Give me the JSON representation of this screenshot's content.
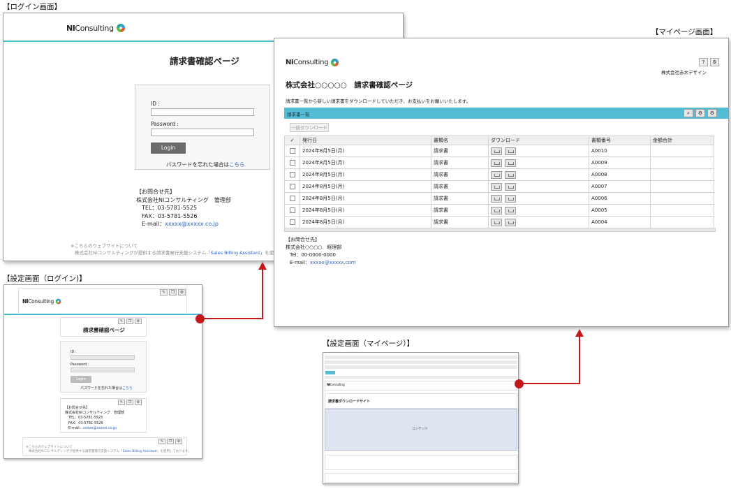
{
  "captions": {
    "login": "【ログイン画面】",
    "mypage": "【マイページ画面】",
    "settings_login": "【設定画面（ログイン)】",
    "settings_mypage": "【設定画面（マイページ）】"
  },
  "brand": {
    "ni": "NI",
    "consulting": "Consulting"
  },
  "login_screen": {
    "title": "請求書確認ページ",
    "id_label": "ID :",
    "password_label": "Password :",
    "login_button": "Login",
    "forgot_text": "パスワードを忘れた場合は",
    "forgot_link": "こちら",
    "contact": {
      "heading": "【お問合せ先】",
      "company": "株式会社NIコンサルティング　管理部",
      "tel": "TEL：03-5781-5525",
      "fax": "FAX：03-5781-5526",
      "email_label": "E-mail：",
      "email": "xxxxx@xxxxx.co.jp"
    },
    "about_heading": "※こちらのウェブサイトについて",
    "about_text": "株式会社NIコンサルティングが提供する請求書発行支援システム「",
    "about_link": "Sales Billing Assistant",
    "about_tail": "」を使用"
  },
  "mypage": {
    "help_icon": "?",
    "company_user": "株式会社赤木デザイン",
    "page_title": "株式会社○○○○○　請求書確認ページ",
    "description": "請求書一覧から新しい請求書をダウンロードしていただき、お支払いをお願いいたします。",
    "list_title": "請求書一覧",
    "bulk_download": "一括ダウンロード",
    "columns": [
      "発行日",
      "書類名",
      "ダウンロード",
      "書類番号",
      "金額合計"
    ],
    "rows": [
      {
        "date": "2024年8月5日(月)",
        "doc": "請求書",
        "no": "A0010"
      },
      {
        "date": "2024年8月5日(月)",
        "doc": "請求書",
        "no": "A0009"
      },
      {
        "date": "2024年8月5日(月)",
        "doc": "請求書",
        "no": "A0008"
      },
      {
        "date": "2024年8月5日(月)",
        "doc": "請求書",
        "no": "A0007"
      },
      {
        "date": "2024年8月5日(月)",
        "doc": "請求書",
        "no": "A0006"
      },
      {
        "date": "2024年8月5日(月)",
        "doc": "請求書",
        "no": "A0005"
      },
      {
        "date": "2024年8月5日(月)",
        "doc": "請求書",
        "no": "A0004"
      }
    ],
    "contact": {
      "heading": "【お問合せ先】",
      "company": "株式会社○○○○　経理部",
      "tel": "Tel：00-0000-0000",
      "email_label": "E-mail：",
      "email": "xxxxx@xxxxx.com"
    }
  },
  "settings_login": {
    "title": "請求書確認ページ",
    "id_label": "ID :",
    "password_label": "Password :",
    "login_button": "Login",
    "forgot_text": "パスワードを忘れた場合は",
    "forgot_link": "こちら",
    "contact": {
      "heading": "【お問合せ先】",
      "company": "株式会社NIコンサルティング　管理部",
      "tel": "TEL：03-5781-5525",
      "fax": "FAX：03-5781-5526",
      "email_label": "E-mail：",
      "email": "xxxxx@xxxxx.co.jp"
    },
    "about_heading": "※こちらのウェブサイトについて",
    "about_text": "株式会社NIコンサルティングが提供する請求書発行支援システム「",
    "about_link": "Sales Billing Assistant",
    "about_tail": "」を使用しております。"
  },
  "settings_mypage": {
    "title": "請求書ダウンロードサイト",
    "center_label": "コンテンツ"
  }
}
